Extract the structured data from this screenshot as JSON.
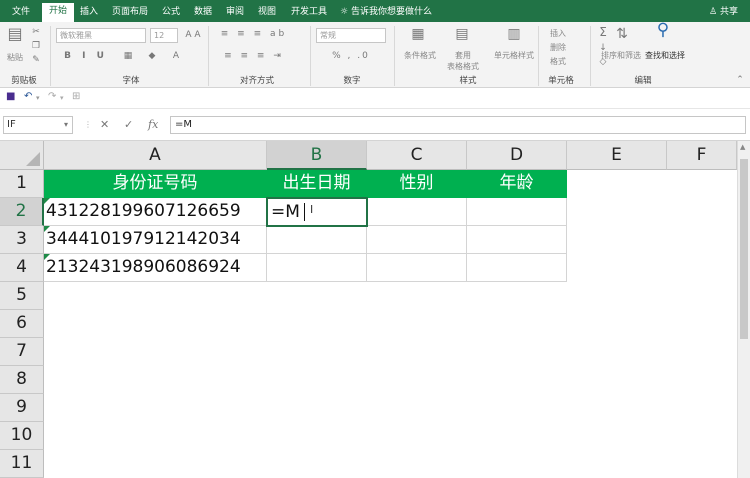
{
  "tabs": [
    "文件",
    "开始",
    "插入",
    "页面布局",
    "公式",
    "数据",
    "审阅",
    "视图",
    "开发工具"
  ],
  "active_tab": "开始",
  "tell_me": "告诉我你想要做什么",
  "share": "共享",
  "ribbon": {
    "groups": {
      "clipboard": "剪贴板",
      "font": "字体",
      "alignment": "对齐方式",
      "number": "数字",
      "styles": "样式",
      "cells": "单元格",
      "editing": "编辑"
    },
    "paste": "粘贴",
    "font_name": "微软雅黑",
    "font_size": "12",
    "number_format": "常规",
    "cond_format": "条件格式",
    "table_format": "套用\n表格格式",
    "cell_styles": "单元格样式",
    "insert": "插入",
    "delete": "删除",
    "format": "格式",
    "sort_filter": "排序和筛选",
    "find_select": "查找和选择"
  },
  "name_box": "IF",
  "formula_bar": "=M",
  "columns": [
    "A",
    "B",
    "C",
    "D",
    "E",
    "F"
  ],
  "rows": [
    "1",
    "2",
    "3",
    "4",
    "5",
    "6",
    "7",
    "8",
    "9",
    "10",
    "11"
  ],
  "headers": [
    "身份证号码",
    "出生日期",
    "性别",
    "年龄"
  ],
  "ids": [
    "431228199607126659",
    "344410197912142034",
    "213243198906086924"
  ],
  "editing_text": "=M",
  "colors": {
    "excel_green": "#217346",
    "header_fill": "#00b050"
  }
}
